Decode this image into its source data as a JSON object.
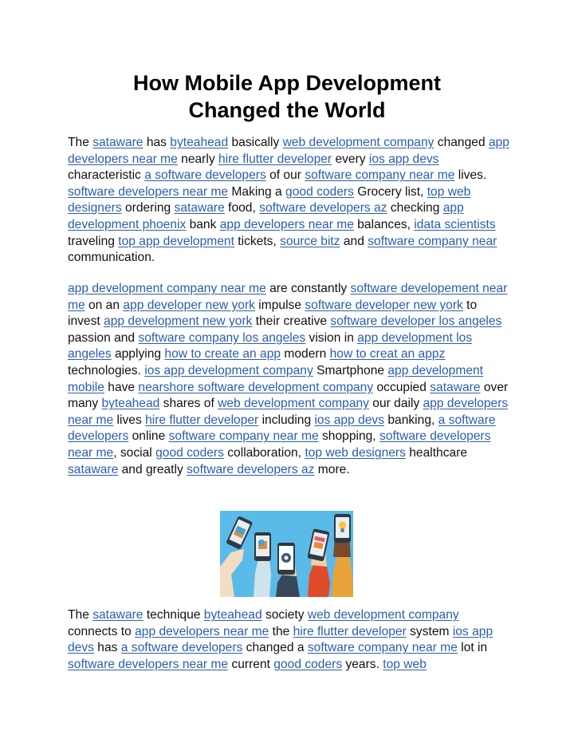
{
  "document": {
    "title_lines": [
      "How Mobile App Development",
      "Changed the World"
    ],
    "paragraphs": [
      [
        {
          "t": "The "
        },
        {
          "l": "sataware"
        },
        {
          "t": " has "
        },
        {
          "l": "byteahead"
        },
        {
          "t": " basically "
        },
        {
          "l": "web development company"
        },
        {
          "t": " changed "
        },
        {
          "l": "app developers near me"
        },
        {
          "t": " nearly "
        },
        {
          "l": "hire flutter developer"
        },
        {
          "t": " every "
        },
        {
          "l": "ios app devs"
        },
        {
          "t": " characteristic "
        },
        {
          "l": "a software developers"
        },
        {
          "t": " of our "
        },
        {
          "l": "software company near me"
        },
        {
          "t": " lives. "
        },
        {
          "l": "software developers near me"
        },
        {
          "t": " Making a "
        },
        {
          "l": "good coders"
        },
        {
          "t": " Grocery list, "
        },
        {
          "l": "top web designers"
        },
        {
          "t": " ordering "
        },
        {
          "l": "sataware"
        },
        {
          "t": " food, "
        },
        {
          "l": "software developers az"
        },
        {
          "t": " checking "
        },
        {
          "l": "app development phoenix"
        },
        {
          "t": " bank "
        },
        {
          "l": "app developers near me"
        },
        {
          "t": " balances, "
        },
        {
          "l": "idata scientists"
        },
        {
          "t": " traveling "
        },
        {
          "l": "top app development"
        },
        {
          "t": " tickets, "
        },
        {
          "l": "source bitz"
        },
        {
          "t": " and "
        },
        {
          "l": "software company near"
        },
        {
          "t": " communication."
        }
      ],
      [
        {
          "l": "app development company near me"
        },
        {
          "t": " are constantly "
        },
        {
          "l": "software developement near me"
        },
        {
          "t": " on an "
        },
        {
          "l": "app developer new york"
        },
        {
          "t": " impulse "
        },
        {
          "l": "software developer new york"
        },
        {
          "t": " to invest "
        },
        {
          "l": "app development new york"
        },
        {
          "t": " their creative "
        },
        {
          "l": "software developer los angeles"
        },
        {
          "t": " passion and "
        },
        {
          "l": "software company los angeles"
        },
        {
          "t": " vision in "
        },
        {
          "l": "app development los angeles"
        },
        {
          "t": " applying "
        },
        {
          "l": "how to create an app"
        },
        {
          "t": " modern "
        },
        {
          "l": "how to creat an appz"
        },
        {
          "t": " technologies. "
        },
        {
          "l": "ios app development company"
        },
        {
          "t": " Smartphone "
        },
        {
          "l": "app development mobile"
        },
        {
          "t": " have "
        },
        {
          "l": "nearshore software development company"
        },
        {
          "t": " occupied "
        },
        {
          "l": "sataware"
        },
        {
          "t": " over many "
        },
        {
          "l": "byteahead"
        },
        {
          "t": " shares of "
        },
        {
          "l": "web development company"
        },
        {
          "t": " our daily "
        },
        {
          "l": "app developers near me"
        },
        {
          "t": " lives "
        },
        {
          "l": "hire flutter developer"
        },
        {
          "t": " including "
        },
        {
          "l": "ios app devs"
        },
        {
          "t": " banking, "
        },
        {
          "l": "a software developers"
        },
        {
          "t": " online "
        },
        {
          "l": "software company near me"
        },
        {
          "t": " shopping, "
        },
        {
          "l": "software developers near me"
        },
        {
          "t": ", social "
        },
        {
          "l": "good coders"
        },
        {
          "t": " collaboration, "
        },
        {
          "l": "top web designers"
        },
        {
          "t": " healthcare "
        },
        {
          "l": "sataware"
        },
        {
          "t": " and greatly "
        },
        {
          "l": "software developers az"
        },
        {
          "t": " more."
        }
      ],
      [
        {
          "t": "The "
        },
        {
          "l": "sataware"
        },
        {
          "t": " technique "
        },
        {
          "l": "byteahead"
        },
        {
          "t": " society "
        },
        {
          "l": "web development company"
        },
        {
          "t": " connects to "
        },
        {
          "l": "app developers near me"
        },
        {
          "t": " the "
        },
        {
          "l": "hire flutter developer"
        },
        {
          "t": " system "
        },
        {
          "l": "ios app devs"
        },
        {
          "t": " has "
        },
        {
          "l": "a software developers"
        },
        {
          "t": " changed a "
        },
        {
          "l": "software company near me"
        },
        {
          "t": " lot in "
        },
        {
          "l": "software developers near me"
        },
        {
          "t": " current "
        },
        {
          "l": "good coders"
        },
        {
          "t": " years. "
        },
        {
          "l": "top web"
        }
      ]
    ],
    "image": {
      "subject": "hands-holding-smartphones-illustration",
      "background_color": "#5bbbe8"
    }
  },
  "colors": {
    "link": "#2a5db0",
    "text": "#111111",
    "background": "#ffffff"
  }
}
